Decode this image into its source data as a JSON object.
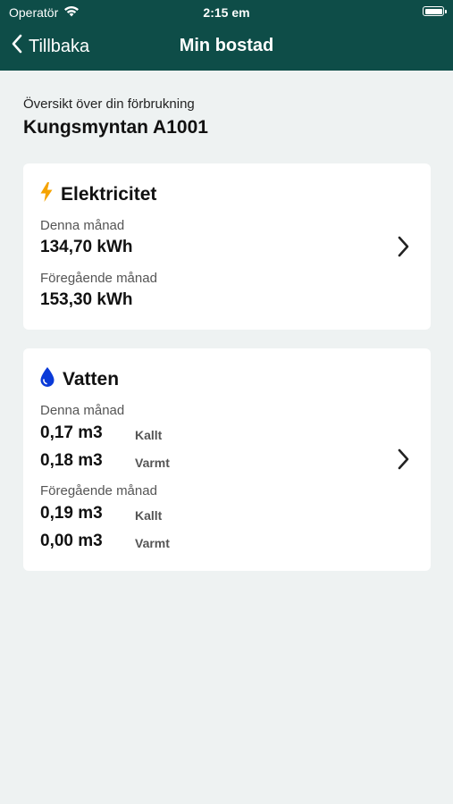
{
  "status_bar": {
    "carrier": "Operatör",
    "time": "2:15 em"
  },
  "nav": {
    "back_label": "Tillbaka",
    "title": "Min bostad"
  },
  "overview": {
    "subtitle": "Översikt över din förbrukning",
    "property": "Kungsmyntan A1001"
  },
  "electricity": {
    "title": "Elektricitet",
    "icon": "bolt-icon",
    "icon_color": "#f5a300",
    "current_label": "Denna månad",
    "current_value": "134,70 kWh",
    "previous_label": "Föregående månad",
    "previous_value": "153,30 kWh"
  },
  "water": {
    "title": "Vatten",
    "icon": "water-drop-icon",
    "icon_color": "#0a3ad8",
    "current_label": "Denna månad",
    "current_cold_value": "0,17 m3",
    "current_cold_tag": "Kallt",
    "current_warm_value": "0,18 m3",
    "current_warm_tag": "Varmt",
    "previous_label": "Föregående månad",
    "previous_cold_value": "0,19 m3",
    "previous_cold_tag": "Kallt",
    "previous_warm_value": "0,00 m3",
    "previous_warm_tag": "Varmt"
  },
  "colors": {
    "header_bg": "#0e4d48",
    "page_bg": "#eef2f2"
  }
}
